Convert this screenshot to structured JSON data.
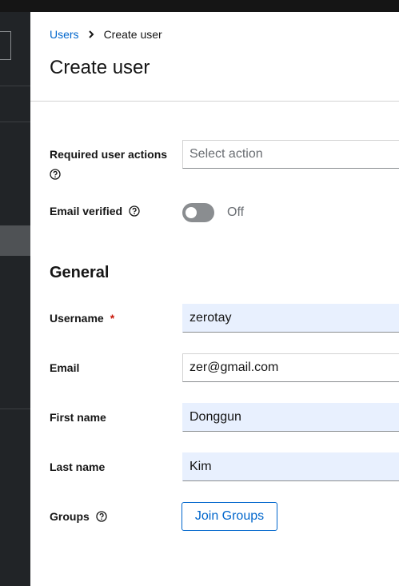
{
  "breadcrumb": {
    "parent": "Users",
    "current": "Create user"
  },
  "page_title": "Create user",
  "required_actions": {
    "label": "Required user actions",
    "placeholder": "Select action"
  },
  "email_verified": {
    "label": "Email verified",
    "state_text": "Off",
    "checked": false
  },
  "general": {
    "title": "General"
  },
  "username": {
    "label": "Username",
    "required_mark": "*",
    "value": "zerotay"
  },
  "email": {
    "label": "Email",
    "value": "zer@gmail.com"
  },
  "first_name": {
    "label": "First name",
    "value": "Donggun"
  },
  "last_name": {
    "label": "Last name",
    "value": "Kim"
  },
  "groups": {
    "label": "Groups",
    "button_label": "Join Groups"
  },
  "colors": {
    "link": "#0066cc",
    "required": "#c9190b",
    "sidebar": "#212427",
    "toggle_off": "#8a8d90",
    "autofill": "#e8f0fe"
  },
  "icons": [
    "chevron-right-icon",
    "help-icon"
  ]
}
